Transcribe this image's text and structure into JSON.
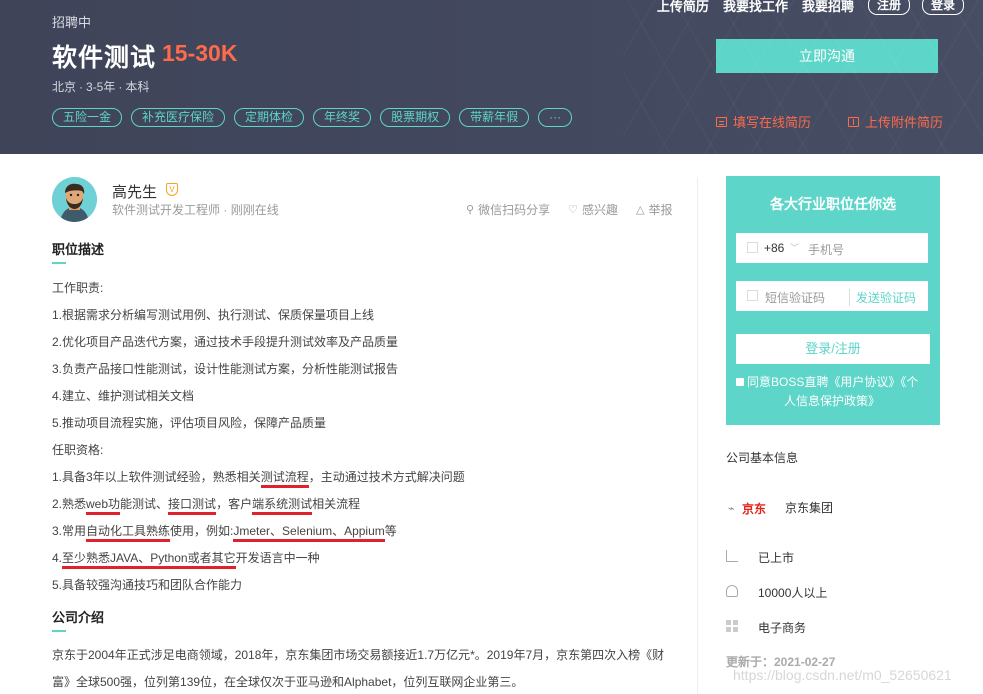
{
  "header": {
    "status": "招聘中",
    "job_title": "软件测试",
    "salary": "15-30K",
    "meta": [
      "北京",
      "3-5年",
      "本科"
    ],
    "tags": [
      "五险一金",
      "补充医疗保险",
      "定期体检",
      "年终奖",
      "股票期权",
      "带薪年假",
      "···"
    ],
    "nav": {
      "upload_resume": "上传简历",
      "find_job": "我要找工作",
      "recruit": "我要招聘",
      "register": "注册",
      "login": "登录"
    },
    "contact_button": "立即沟通",
    "fill_resume": "填写在线简历",
    "upload_attachment": "上传附件简历"
  },
  "recruiter": {
    "name": "高先生",
    "verify_badge": "V",
    "title": "软件测试开发工程师",
    "online": "刚刚在线",
    "actions": {
      "share": "微信扫码分享",
      "interest": "感兴趣",
      "report": "举报"
    }
  },
  "description": {
    "heading": "职位描述",
    "duties_label": "工作职责:",
    "duties": [
      "1.根据需求分析编写测试用例、执行测试、保质保量项目上线",
      "2.优化项目产品迭代方案，通过技术手段提升测试效率及产品质量",
      "3.负责产品接口性能测试，设计性能测试方案，分析性能测试报告",
      "4.建立、维护测试相关文档",
      "5.推动项目流程实施，评估项目风险，保障产品质量"
    ],
    "req_label": "任职资格:",
    "req1": {
      "a": "1.具备3年以上软件测试经验，熟悉相关",
      "u": "测试流程",
      "b": "，主动通过技术方式解决问题"
    },
    "req2": {
      "a": "2.熟悉",
      "u1": "web功",
      "b": "能测试、",
      "u2": "接口测试",
      "c": "，客户",
      "u3": "端系统测试",
      "d": "相关流程"
    },
    "req3": {
      "a": "3.常用",
      "u1": "自动化工具熟练",
      "b": "使用，例如:",
      "u2": "Jmeter、Selenium、Appium",
      "c": "等"
    },
    "req4": {
      "a": "4.",
      "u": "至少熟悉JAVA、Python或者其它",
      "b": "开发语言中一种"
    },
    "req5": "5.具备较强沟通技巧和团队合作能力"
  },
  "company_intro": {
    "heading": "公司介绍",
    "text": "京东于2004年正式涉足电商领域，2018年，京东集团市场交易额接近1.7万亿元*。2019年7月，京东第四次入榜《财富》全球500强，位列第139位，在全球仅次于亚马逊和Alphabet，位列互联网企业第三。"
  },
  "login_panel": {
    "title": "各大行业职位任你选",
    "country_code": "+86",
    "phone_placeholder": "手机号",
    "code_placeholder": "短信验证码",
    "send_code": "发送验证码",
    "submit": "登录/注册",
    "agree_line1": "同意BOSS直聘《用户协议》《个",
    "agree_line2": "人信息保护政策》"
  },
  "company_info": {
    "heading": "公司基本信息",
    "logo_text": "京东",
    "name": "京东集团",
    "stage": "已上市",
    "size": "10000人以上",
    "industry": "电子商务",
    "updated": "更新于：2021-02-27"
  },
  "watermark": "https://blog.csdn.net/m0_52650621",
  "colors": {
    "accent": "#5dd5c8",
    "salary": "#ff6a4b",
    "header_bg": "#42485e",
    "underline": "#e0222c"
  }
}
